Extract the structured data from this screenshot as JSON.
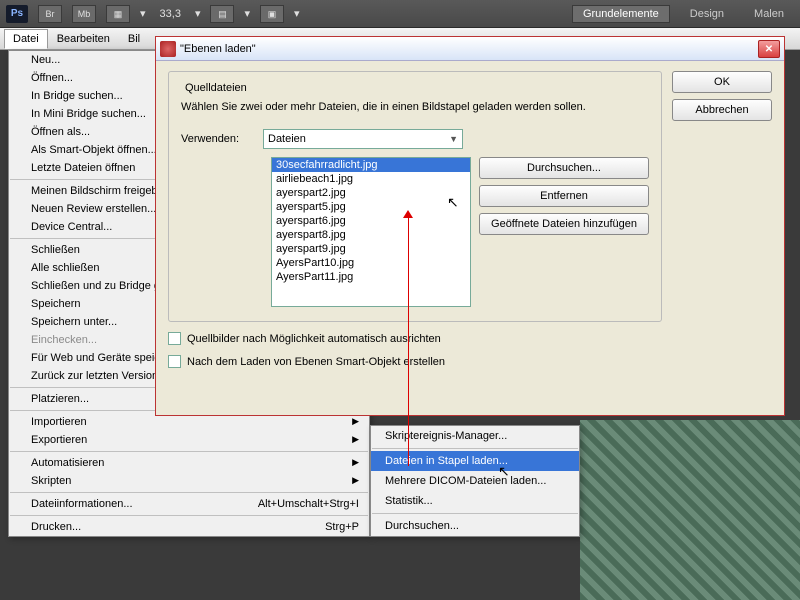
{
  "topbar": {
    "ps": "Ps",
    "br": "Br",
    "mb": "Mb",
    "zoom": "33,3",
    "panels": {
      "grund": "Grundelemente",
      "design": "Design",
      "malen": "Malen"
    }
  },
  "menubar": {
    "datei": "Datei",
    "bearbeiten": "Bearbeiten",
    "bild": "Bil"
  },
  "menu": {
    "neu": "Neu...",
    "oeffnen": "Öffnen...",
    "bridge": "In Bridge suchen...",
    "minibridge": "In Mini Bridge suchen...",
    "oeffnenals": "Öffnen als...",
    "smartobj": "Als Smart-Objekt öffnen...",
    "letzte": "Letzte Dateien öffnen",
    "bildschirm": "Meinen Bildschirm freigeben...",
    "review": "Neuen Review erstellen...",
    "devicecentral": "Device Central...",
    "schliessen": "Schließen",
    "alle": "Alle schließen",
    "bridge2": "Schließen und zu Bridge gehen...",
    "speichern": "Speichern",
    "speichernunter": "Speichern unter...",
    "einchecken": "Einchecken...",
    "webgeraete": "Für Web und Geräte speichern...",
    "zurueck": "Zurück zur letzten Version",
    "platzieren": "Platzieren...",
    "importieren": "Importieren",
    "exportieren": "Exportieren",
    "automatisieren": "Automatisieren",
    "skripten": "Skripten",
    "dateiinfo": "Dateiinformationen...",
    "dateiinfo_hk": "Alt+Umschalt+Strg+I",
    "drucken": "Drucken...",
    "drucken_hk": "Strg+P"
  },
  "submenu": {
    "skriptmanager": "Skriptereignis-Manager...",
    "stapel": "Dateien in Stapel laden...",
    "dicom": "Mehrere DICOM-Dateien laden...",
    "statistik": "Statistik...",
    "durchsuchen": "Durchsuchen..."
  },
  "dialog": {
    "title": "\"Ebenen laden\"",
    "ok": "OK",
    "cancel": "Abbrechen",
    "group": "Quelldateien",
    "instr": "Wählen Sie zwei oder mehr Dateien, die in einen Bildstapel geladen werden sollen.",
    "verwenden": "Verwenden:",
    "verwenden_val": "Dateien",
    "durchsuchen": "Durchsuchen...",
    "entfernen": "Entfernen",
    "geoeffnete": "Geöffnete Dateien hinzufügen",
    "files": [
      "30secfahrradlicht.jpg",
      "airliebeach1.jpg",
      "ayerspart2.jpg",
      "ayerspart5.jpg",
      "ayerspart6.jpg",
      "ayerspart8.jpg",
      "ayerspart9.jpg",
      "AyersPart10.jpg",
      "AyersPart11.jpg"
    ],
    "chk1": "Quellbilder nach Möglichkeit automatisch ausrichten",
    "chk2": "Nach dem Laden von Ebenen Smart-Objekt erstellen"
  }
}
